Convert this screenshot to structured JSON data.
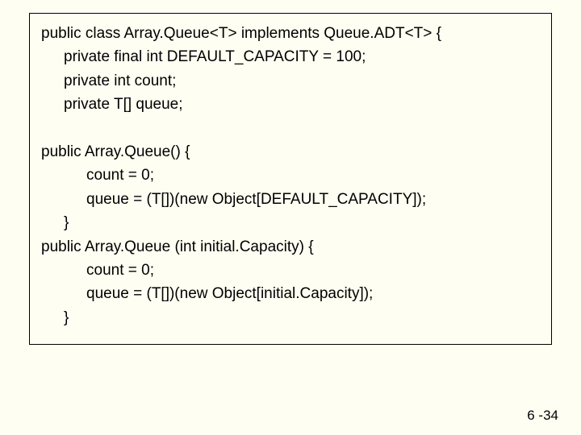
{
  "code": {
    "l1": "public class Array.Queue<T> implements Queue.ADT<T> {",
    "l2": "private final int DEFAULT_CAPACITY = 100;",
    "l3": "private int count;",
    "l4": "private T[] queue;",
    "l5": "public Array.Queue() {",
    "l6": "count = 0;",
    "l7": "queue = (T[])(new Object[DEFAULT_CAPACITY]);",
    "l8": "}",
    "l9": "public Array.Queue (int initial.Capacity) {",
    "l10": "count = 0;",
    "l11": "queue = (T[])(new Object[initial.Capacity]);",
    "l12": "}"
  },
  "page_number": "6 -34"
}
